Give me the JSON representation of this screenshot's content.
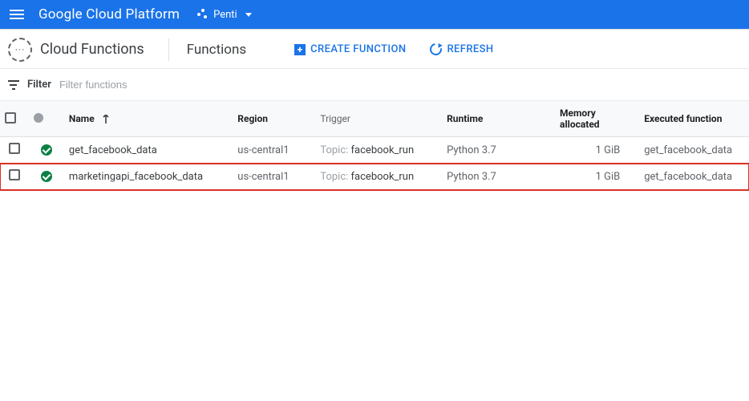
{
  "header": {
    "brand": "Google Cloud Platform",
    "project": "Penti"
  },
  "titlebar": {
    "service_icon_text": "(···)",
    "page_title": "Cloud Functions",
    "sub_title": "Functions",
    "create_label": "CREATE FUNCTION",
    "refresh_label": "REFRESH"
  },
  "filter": {
    "label": "Filter",
    "placeholder": "Filter functions"
  },
  "table": {
    "columns": {
      "name": "Name",
      "region": "Region",
      "trigger": "Trigger",
      "runtime": "Runtime",
      "memory": "Memory allocated",
      "executed": "Executed function"
    },
    "rows": [
      {
        "name": "get_facebook_data",
        "region": "us-central1",
        "trigger_label": "Topic: ",
        "trigger_value": "facebook_run",
        "runtime": "Python 3.7",
        "memory": "1 GiB",
        "executed": "get_facebook_data",
        "highlight": false
      },
      {
        "name": "marketingapi_facebook_data",
        "region": "us-central1",
        "trigger_label": "Topic: ",
        "trigger_value": "facebook_run",
        "runtime": "Python 3.7",
        "memory": "1 GiB",
        "executed": "get_facebook_data",
        "highlight": true
      }
    ]
  }
}
